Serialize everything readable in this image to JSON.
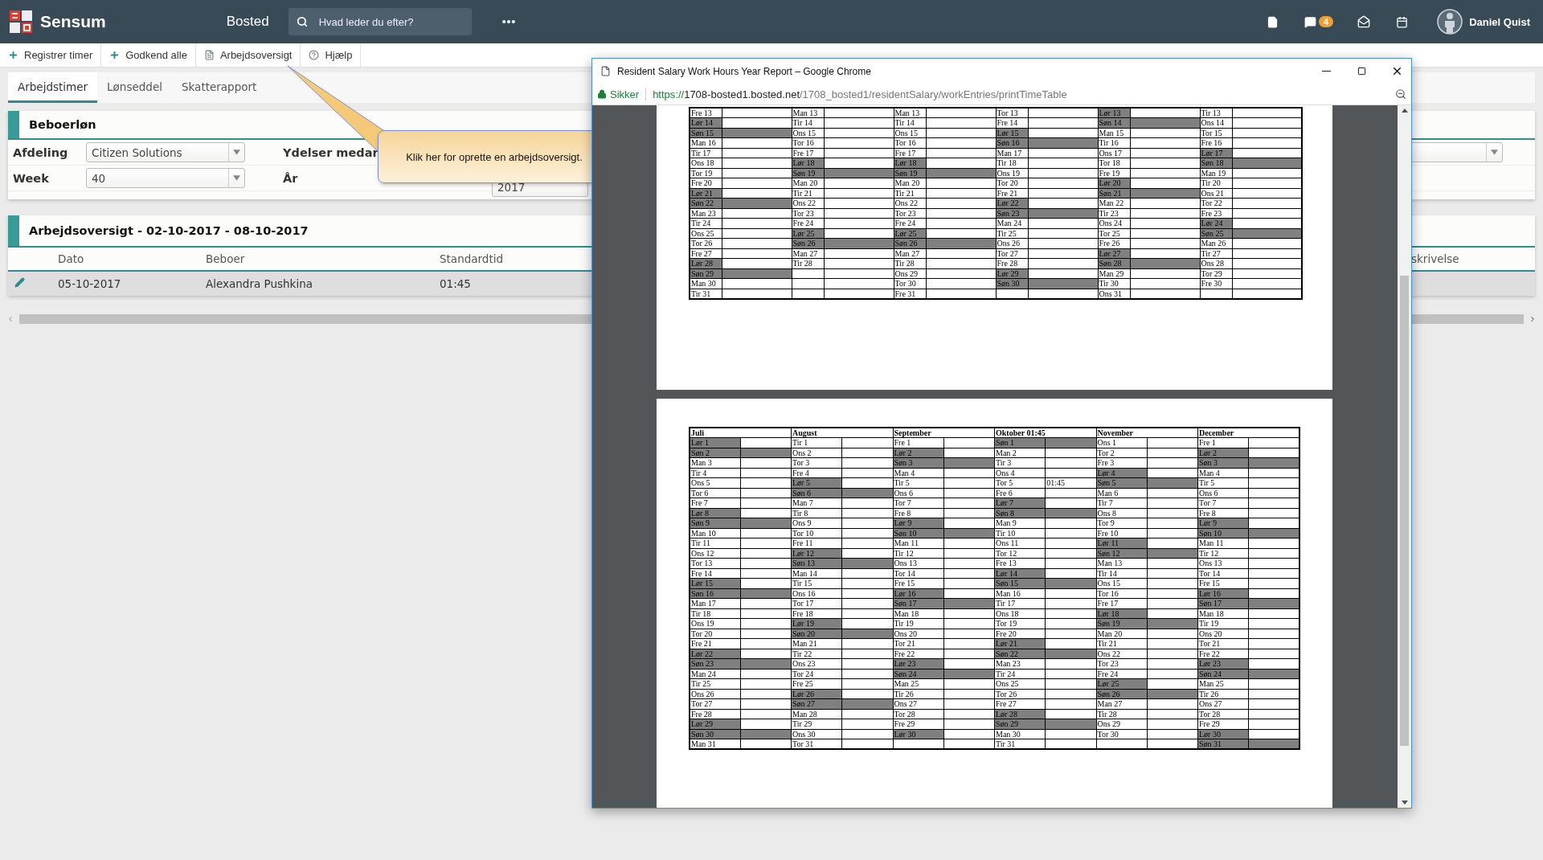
{
  "header": {
    "brand": "Sensum",
    "module": "Bosted",
    "search_placeholder": "Hvad leder du efter?",
    "chat_badge": "4",
    "user": "Daniel Quist"
  },
  "toolbar": [
    {
      "label": "Registrer timer"
    },
    {
      "label": "Godkend alle"
    },
    {
      "label": "Arbejdsoversigt"
    },
    {
      "label": "Hjælp"
    }
  ],
  "tabs": [
    {
      "label": "Arbejdstimer",
      "selected": true
    },
    {
      "label": "Lønseddel",
      "selected": false
    },
    {
      "label": "Skatterapport",
      "selected": false
    }
  ],
  "form": {
    "title": "Beboerløn",
    "fields": [
      {
        "label": "Afdeling",
        "value": "Citizen Solutions"
      },
      {
        "label": "Week",
        "value": "40"
      }
    ],
    "label_3": "Ydelser medar",
    "label_4": "År",
    "year_value": "2017"
  },
  "overview": {
    "title": "Arbejdsoversigt - 02-10-2017 - 08-10-2017",
    "columns": [
      "Dato",
      "Beboer",
      "Standardtid"
    ],
    "column_last": "skrivelse",
    "rows": [
      {
        "cells": [
          "05-10-2017",
          "Alexandra Pushkina",
          "01:45"
        ]
      }
    ]
  },
  "tooltip": "Klik her for oprette en arbejdsoversigt.",
  "popup": {
    "title": "Resident Salary Work Hours Year Report – Google Chrome",
    "secure_label": "Sikker",
    "url": {
      "scheme": "https://",
      "host": "1708-bosted1.bosted.net",
      "path": "/1708_bosted1/residentSalary/workEntries/printTimeTable"
    },
    "top_months": [
      {
        "days": [
          {
            "label": "Fre 13",
            "kind": "weekday"
          },
          {
            "label": "Lør 14",
            "kind": "saturday"
          },
          {
            "label": "Søn 15",
            "kind": "sunday"
          },
          {
            "label": "Man 16",
            "kind": "weekday"
          },
          {
            "label": "Tir 17",
            "kind": "weekday"
          },
          {
            "label": "Ons 18",
            "kind": "weekday"
          },
          {
            "label": "Tor 19",
            "kind": "weekday"
          },
          {
            "label": "Fre 20",
            "kind": "weekday"
          },
          {
            "label": "Lør 21",
            "kind": "saturday"
          },
          {
            "label": "Søn 22",
            "kind": "sunday"
          },
          {
            "label": "Man 23",
            "kind": "weekday"
          },
          {
            "label": "Tir 24",
            "kind": "weekday"
          },
          {
            "label": "Ons 25",
            "kind": "weekday"
          },
          {
            "label": "Tor 26",
            "kind": "weekday"
          },
          {
            "label": "Fre 27",
            "kind": "weekday"
          },
          {
            "label": "Lør 28",
            "kind": "saturday"
          },
          {
            "label": "Søn 29",
            "kind": "sunday"
          },
          {
            "label": "Man 30",
            "kind": "weekday"
          },
          {
            "label": "Tir 31",
            "kind": "weekday"
          }
        ]
      },
      {
        "days": [
          {
            "label": "Man 13",
            "kind": "weekday"
          },
          {
            "label": "Tir 14",
            "kind": "weekday"
          },
          {
            "label": "Ons 15",
            "kind": "weekday"
          },
          {
            "label": "Tor 16",
            "kind": "weekday"
          },
          {
            "label": "Fre 17",
            "kind": "weekday"
          },
          {
            "label": "Lør 18",
            "kind": "saturday"
          },
          {
            "label": "Søn 19",
            "kind": "sunday"
          },
          {
            "label": "Man 20",
            "kind": "weekday"
          },
          {
            "label": "Tir 21",
            "kind": "weekday"
          },
          {
            "label": "Ons 22",
            "kind": "weekday"
          },
          {
            "label": "Tor 23",
            "kind": "weekday"
          },
          {
            "label": "Fre 24",
            "kind": "weekday"
          },
          {
            "label": "Lør 25",
            "kind": "saturday"
          },
          {
            "label": "Søn 26",
            "kind": "sunday"
          },
          {
            "label": "Man 27",
            "kind": "weekday"
          },
          {
            "label": "Tir 28",
            "kind": "weekday"
          }
        ]
      },
      {
        "days": [
          {
            "label": "Man 13",
            "kind": "weekday"
          },
          {
            "label": "Tir 14",
            "kind": "weekday"
          },
          {
            "label": "Ons 15",
            "kind": "weekday"
          },
          {
            "label": "Tor 16",
            "kind": "weekday"
          },
          {
            "label": "Fre 17",
            "kind": "weekday"
          },
          {
            "label": "Lør 18",
            "kind": "saturday"
          },
          {
            "label": "Søn 19",
            "kind": "sunday"
          },
          {
            "label": "Man 20",
            "kind": "weekday"
          },
          {
            "label": "Tir 21",
            "kind": "weekday"
          },
          {
            "label": "Ons 22",
            "kind": "weekday"
          },
          {
            "label": "Tor 23",
            "kind": "weekday"
          },
          {
            "label": "Fre 24",
            "kind": "weekday"
          },
          {
            "label": "Lør 25",
            "kind": "saturday"
          },
          {
            "label": "Søn 26",
            "kind": "sunday"
          },
          {
            "label": "Man 27",
            "kind": "weekday"
          },
          {
            "label": "Tir 28",
            "kind": "weekday"
          },
          {
            "label": "Ons 29",
            "kind": "weekday"
          },
          {
            "label": "Tor 30",
            "kind": "weekday"
          },
          {
            "label": "Fre 31",
            "kind": "weekday"
          }
        ]
      },
      {
        "days": [
          {
            "label": "Tor 13",
            "kind": "weekday"
          },
          {
            "label": "Fre 14",
            "kind": "weekday"
          },
          {
            "label": "Lør 15",
            "kind": "saturday"
          },
          {
            "label": "Søn 16",
            "kind": "sunday"
          },
          {
            "label": "Man 17",
            "kind": "weekday"
          },
          {
            "label": "Tir 18",
            "kind": "weekday"
          },
          {
            "label": "Ons 19",
            "kind": "weekday"
          },
          {
            "label": "Tor 20",
            "kind": "weekday"
          },
          {
            "label": "Fre 21",
            "kind": "weekday"
          },
          {
            "label": "Lør 22",
            "kind": "saturday"
          },
          {
            "label": "Søn 23",
            "kind": "sunday"
          },
          {
            "label": "Man 24",
            "kind": "weekday"
          },
          {
            "label": "Tir 25",
            "kind": "weekday"
          },
          {
            "label": "Ons 26",
            "kind": "weekday"
          },
          {
            "label": "Tor 27",
            "kind": "weekday"
          },
          {
            "label": "Fre 28",
            "kind": "weekday"
          },
          {
            "label": "Lør 29",
            "kind": "saturday"
          },
          {
            "label": "Søn 30",
            "kind": "sunday"
          }
        ]
      },
      {
        "days": [
          {
            "label": "Lør 13",
            "kind": "saturday"
          },
          {
            "label": "Søn 14",
            "kind": "sunday"
          },
          {
            "label": "Man 15",
            "kind": "weekday"
          },
          {
            "label": "Tir 16",
            "kind": "weekday"
          },
          {
            "label": "Ons 17",
            "kind": "weekday"
          },
          {
            "label": "Tor 18",
            "kind": "weekday"
          },
          {
            "label": "Fre 19",
            "kind": "weekday"
          },
          {
            "label": "Lør 20",
            "kind": "saturday"
          },
          {
            "label": "Søn 21",
            "kind": "sunday"
          },
          {
            "label": "Man 22",
            "kind": "weekday"
          },
          {
            "label": "Tir 23",
            "kind": "weekday"
          },
          {
            "label": "Ons 24",
            "kind": "weekday"
          },
          {
            "label": "Tor 25",
            "kind": "weekday"
          },
          {
            "label": "Fre 26",
            "kind": "weekday"
          },
          {
            "label": "Lør 27",
            "kind": "saturday"
          },
          {
            "label": "Søn 28",
            "kind": "sunday"
          },
          {
            "label": "Man 29",
            "kind": "weekday"
          },
          {
            "label": "Tir 30",
            "kind": "weekday"
          },
          {
            "label": "Ons 31",
            "kind": "weekday"
          }
        ]
      },
      {
        "days": [
          {
            "label": "Tir 13",
            "kind": "weekday"
          },
          {
            "label": "Ons 14",
            "kind": "weekday"
          },
          {
            "label": "Tor 15",
            "kind": "weekday"
          },
          {
            "label": "Fre 16",
            "kind": "weekday"
          },
          {
            "label": "Lør 17",
            "kind": "saturday"
          },
          {
            "label": "Søn 18",
            "kind": "sunday"
          },
          {
            "label": "Man 19",
            "kind": "weekday"
          },
          {
            "label": "Tir 20",
            "kind": "weekday"
          },
          {
            "label": "Ons 21",
            "kind": "weekday"
          },
          {
            "label": "Tor 22",
            "kind": "weekday"
          },
          {
            "label": "Fre 23",
            "kind": "weekday"
          },
          {
            "label": "Lør 24",
            "kind": "saturday"
          },
          {
            "label": "Søn 25",
            "kind": "sunday"
          },
          {
            "label": "Man 26",
            "kind": "weekday"
          },
          {
            "label": "Tir 27",
            "kind": "weekday"
          },
          {
            "label": "Ons 28",
            "kind": "weekday"
          },
          {
            "label": "Tor 29",
            "kind": "weekday"
          },
          {
            "label": "Fre 30",
            "kind": "weekday"
          }
        ]
      }
    ],
    "bottom_months": [
      {
        "name": "Juli",
        "days": [
          {
            "label": "Lør 1",
            "kind": "saturday"
          },
          {
            "label": "Søn 2",
            "kind": "sunday"
          },
          {
            "label": "Man 3",
            "kind": "weekday"
          },
          {
            "label": "Tir 4",
            "kind": "weekday"
          },
          {
            "label": "Ons 5",
            "kind": "weekday"
          },
          {
            "label": "Tor 6",
            "kind": "weekday"
          },
          {
            "label": "Fre 7",
            "kind": "weekday"
          },
          {
            "label": "Lør 8",
            "kind": "saturday"
          },
          {
            "label": "Søn 9",
            "kind": "sunday"
          },
          {
            "label": "Man 10",
            "kind": "weekday"
          },
          {
            "label": "Tir 11",
            "kind": "weekday"
          },
          {
            "label": "Ons 12",
            "kind": "weekday"
          },
          {
            "label": "Tor 13",
            "kind": "weekday"
          },
          {
            "label": "Fre 14",
            "kind": "weekday"
          },
          {
            "label": "Lør 15",
            "kind": "saturday"
          },
          {
            "label": "Søn 16",
            "kind": "sunday"
          },
          {
            "label": "Man 17",
            "kind": "weekday"
          },
          {
            "label": "Tir 18",
            "kind": "weekday"
          },
          {
            "label": "Ons 19",
            "kind": "weekday"
          },
          {
            "label": "Tor 20",
            "kind": "weekday"
          },
          {
            "label": "Fre 21",
            "kind": "weekday"
          },
          {
            "label": "Lør 22",
            "kind": "saturday"
          },
          {
            "label": "Søn 23",
            "kind": "sunday"
          },
          {
            "label": "Man 24",
            "kind": "weekday"
          },
          {
            "label": "Tir 25",
            "kind": "weekday"
          },
          {
            "label": "Ons 26",
            "kind": "weekday"
          },
          {
            "label": "Tor 27",
            "kind": "weekday"
          },
          {
            "label": "Fre 28",
            "kind": "weekday"
          },
          {
            "label": "Lør 29",
            "kind": "saturday"
          },
          {
            "label": "Søn 30",
            "kind": "sunday"
          },
          {
            "label": "Man 31",
            "kind": "weekday"
          }
        ]
      },
      {
        "name": "August",
        "days": [
          {
            "label": "Tir 1",
            "kind": "weekday"
          },
          {
            "label": "Ons 2",
            "kind": "weekday"
          },
          {
            "label": "Tor 3",
            "kind": "weekday"
          },
          {
            "label": "Fre 4",
            "kind": "weekday"
          },
          {
            "label": "Lør 5",
            "kind": "saturday"
          },
          {
            "label": "Søn 6",
            "kind": "sunday"
          },
          {
            "label": "Man 7",
            "kind": "weekday"
          },
          {
            "label": "Tir 8",
            "kind": "weekday"
          },
          {
            "label": "Ons 9",
            "kind": "weekday"
          },
          {
            "label": "Tor 10",
            "kind": "weekday"
          },
          {
            "label": "Fre 11",
            "kind": "weekday"
          },
          {
            "label": "Lør 12",
            "kind": "saturday"
          },
          {
            "label": "Søn 13",
            "kind": "sunday"
          },
          {
            "label": "Man 14",
            "kind": "weekday"
          },
          {
            "label": "Tir 15",
            "kind": "weekday"
          },
          {
            "label": "Ons 16",
            "kind": "weekday"
          },
          {
            "label": "Tor 17",
            "kind": "weekday"
          },
          {
            "label": "Fre 18",
            "kind": "weekday"
          },
          {
            "label": "Lør 19",
            "kind": "saturday"
          },
          {
            "label": "Søn 20",
            "kind": "sunday"
          },
          {
            "label": "Man 21",
            "kind": "weekday"
          },
          {
            "label": "Tir 22",
            "kind": "weekday"
          },
          {
            "label": "Ons 23",
            "kind": "weekday"
          },
          {
            "label": "Tor 24",
            "kind": "weekday"
          },
          {
            "label": "Fre 25",
            "kind": "weekday"
          },
          {
            "label": "Lør 26",
            "kind": "saturday"
          },
          {
            "label": "Søn 27",
            "kind": "sunday"
          },
          {
            "label": "Man 28",
            "kind": "weekday"
          },
          {
            "label": "Tir 29",
            "kind": "weekday"
          },
          {
            "label": "Ons 30",
            "kind": "weekday"
          },
          {
            "label": "Tor 31",
            "kind": "weekday"
          }
        ]
      },
      {
        "name": "September",
        "days": [
          {
            "label": "Fre 1",
            "kind": "weekday"
          },
          {
            "label": "Lør 2",
            "kind": "saturday"
          },
          {
            "label": "Søn 3",
            "kind": "sunday"
          },
          {
            "label": "Man 4",
            "kind": "weekday"
          },
          {
            "label": "Tir 5",
            "kind": "weekday"
          },
          {
            "label": "Ons 6",
            "kind": "weekday"
          },
          {
            "label": "Tor 7",
            "kind": "weekday"
          },
          {
            "label": "Fre 8",
            "kind": "weekday"
          },
          {
            "label": "Lør 9",
            "kind": "saturday"
          },
          {
            "label": "Søn 10",
            "kind": "sunday"
          },
          {
            "label": "Man 11",
            "kind": "weekday"
          },
          {
            "label": "Tir 12",
            "kind": "weekday"
          },
          {
            "label": "Ons 13",
            "kind": "weekday"
          },
          {
            "label": "Tor 14",
            "kind": "weekday"
          },
          {
            "label": "Fre 15",
            "kind": "weekday"
          },
          {
            "label": "Lør 16",
            "kind": "saturday"
          },
          {
            "label": "Søn 17",
            "kind": "sunday"
          },
          {
            "label": "Man 18",
            "kind": "weekday"
          },
          {
            "label": "Tir 19",
            "kind": "weekday"
          },
          {
            "label": "Ons 20",
            "kind": "weekday"
          },
          {
            "label": "Tor 21",
            "kind": "weekday"
          },
          {
            "label": "Fre 22",
            "kind": "weekday"
          },
          {
            "label": "Lør 23",
            "kind": "saturday"
          },
          {
            "label": "Søn 24",
            "kind": "sunday"
          },
          {
            "label": "Man 25",
            "kind": "weekday"
          },
          {
            "label": "Tir 26",
            "kind": "weekday"
          },
          {
            "label": "Ons 27",
            "kind": "weekday"
          },
          {
            "label": "Tor 28",
            "kind": "weekday"
          },
          {
            "label": "Fre 29",
            "kind": "weekday"
          },
          {
            "label": "Lør 30",
            "kind": "saturday"
          }
        ]
      },
      {
        "name": "Oktober 01:45",
        "days": [
          {
            "label": "Søn 1",
            "kind": "sunday"
          },
          {
            "label": "Man 2",
            "kind": "weekday"
          },
          {
            "label": "Tir 3",
            "kind": "weekday"
          },
          {
            "label": "Ons 4",
            "kind": "weekday"
          },
          {
            "label": "Tor 5",
            "kind": "weekday",
            "hours": "01:45"
          },
          {
            "label": "Fre 6",
            "kind": "weekday"
          },
          {
            "label": "Lør 7",
            "kind": "saturday"
          },
          {
            "label": "Søn 8",
            "kind": "sunday"
          },
          {
            "label": "Man 9",
            "kind": "weekday"
          },
          {
            "label": "Tir 10",
            "kind": "weekday"
          },
          {
            "label": "Ons 11",
            "kind": "weekday"
          },
          {
            "label": "Tor 12",
            "kind": "weekday"
          },
          {
            "label": "Fre 13",
            "kind": "weekday"
          },
          {
            "label": "Lør 14",
            "kind": "saturday"
          },
          {
            "label": "Søn 15",
            "kind": "sunday"
          },
          {
            "label": "Man 16",
            "kind": "weekday"
          },
          {
            "label": "Tir 17",
            "kind": "weekday"
          },
          {
            "label": "Ons 18",
            "kind": "weekday"
          },
          {
            "label": "Tor 19",
            "kind": "weekday"
          },
          {
            "label": "Fre 20",
            "kind": "weekday"
          },
          {
            "label": "Lør 21",
            "kind": "saturday"
          },
          {
            "label": "Søn 22",
            "kind": "sunday"
          },
          {
            "label": "Man 23",
            "kind": "weekday"
          },
          {
            "label": "Tir 24",
            "kind": "weekday"
          },
          {
            "label": "Ons 25",
            "kind": "weekday"
          },
          {
            "label": "Tor 26",
            "kind": "weekday"
          },
          {
            "label": "Fre 27",
            "kind": "weekday"
          },
          {
            "label": "Lør 28",
            "kind": "saturday"
          },
          {
            "label": "Søn 29",
            "kind": "sunday"
          },
          {
            "label": "Man 30",
            "kind": "weekday"
          },
          {
            "label": "Tir 31",
            "kind": "weekday"
          }
        ]
      },
      {
        "name": "November",
        "days": [
          {
            "label": "Ons 1",
            "kind": "weekday"
          },
          {
            "label": "Tor 2",
            "kind": "weekday"
          },
          {
            "label": "Fre 3",
            "kind": "weekday"
          },
          {
            "label": "Lør 4",
            "kind": "saturday"
          },
          {
            "label": "Søn 5",
            "kind": "sunday"
          },
          {
            "label": "Man 6",
            "kind": "weekday"
          },
          {
            "label": "Tir 7",
            "kind": "weekday"
          },
          {
            "label": "Ons 8",
            "kind": "weekday"
          },
          {
            "label": "Tor 9",
            "kind": "weekday"
          },
          {
            "label": "Fre 10",
            "kind": "weekday"
          },
          {
            "label": "Lør 11",
            "kind": "saturday"
          },
          {
            "label": "Søn 12",
            "kind": "sunday"
          },
          {
            "label": "Man 13",
            "kind": "weekday"
          },
          {
            "label": "Tir 14",
            "kind": "weekday"
          },
          {
            "label": "Ons 15",
            "kind": "weekday"
          },
          {
            "label": "Tor 16",
            "kind": "weekday"
          },
          {
            "label": "Fre 17",
            "kind": "weekday"
          },
          {
            "label": "Lør 18",
            "kind": "saturday"
          },
          {
            "label": "Søn 19",
            "kind": "sunday"
          },
          {
            "label": "Man 20",
            "kind": "weekday"
          },
          {
            "label": "Tir 21",
            "kind": "weekday"
          },
          {
            "label": "Ons 22",
            "kind": "weekday"
          },
          {
            "label": "Tor 23",
            "kind": "weekday"
          },
          {
            "label": "Fre 24",
            "kind": "weekday"
          },
          {
            "label": "Lør 25",
            "kind": "saturday"
          },
          {
            "label": "Søn 26",
            "kind": "sunday"
          },
          {
            "label": "Man 27",
            "kind": "weekday"
          },
          {
            "label": "Tir 28",
            "kind": "weekday"
          },
          {
            "label": "Ons 29",
            "kind": "weekday"
          },
          {
            "label": "Tor 30",
            "kind": "weekday"
          }
        ]
      },
      {
        "name": "December",
        "days": [
          {
            "label": "Fre 1",
            "kind": "weekday"
          },
          {
            "label": "Lør 2",
            "kind": "saturday"
          },
          {
            "label": "Søn 3",
            "kind": "sunday"
          },
          {
            "label": "Man 4",
            "kind": "weekday"
          },
          {
            "label": "Tir 5",
            "kind": "weekday"
          },
          {
            "label": "Ons 6",
            "kind": "weekday"
          },
          {
            "label": "Tor 7",
            "kind": "weekday"
          },
          {
            "label": "Fre 8",
            "kind": "weekday"
          },
          {
            "label": "Lør 9",
            "kind": "saturday"
          },
          {
            "label": "Søn 10",
            "kind": "sunday"
          },
          {
            "label": "Man 11",
            "kind": "weekday"
          },
          {
            "label": "Tir 12",
            "kind": "weekday"
          },
          {
            "label": "Ons 13",
            "kind": "weekday"
          },
          {
            "label": "Tor 14",
            "kind": "weekday"
          },
          {
            "label": "Fre 15",
            "kind": "weekday"
          },
          {
            "label": "Lør 16",
            "kind": "saturday"
          },
          {
            "label": "Søn 17",
            "kind": "sunday"
          },
          {
            "label": "Man 18",
            "kind": "weekday"
          },
          {
            "label": "Tir 19",
            "kind": "weekday"
          },
          {
            "label": "Ons 20",
            "kind": "weekday"
          },
          {
            "label": "Tor 21",
            "kind": "weekday"
          },
          {
            "label": "Fre 22",
            "kind": "weekday"
          },
          {
            "label": "Lør 23",
            "kind": "saturday"
          },
          {
            "label": "Søn 24",
            "kind": "sunday"
          },
          {
            "label": "Man 25",
            "kind": "weekday"
          },
          {
            "label": "Tir 26",
            "kind": "weekday"
          },
          {
            "label": "Ons 27",
            "kind": "weekday"
          },
          {
            "label": "Tor 28",
            "kind": "weekday"
          },
          {
            "label": "Fre 29",
            "kind": "weekday"
          },
          {
            "label": "Lør 30",
            "kind": "saturday"
          },
          {
            "label": "Søn 31",
            "kind": "sunday"
          }
        ]
      }
    ]
  }
}
